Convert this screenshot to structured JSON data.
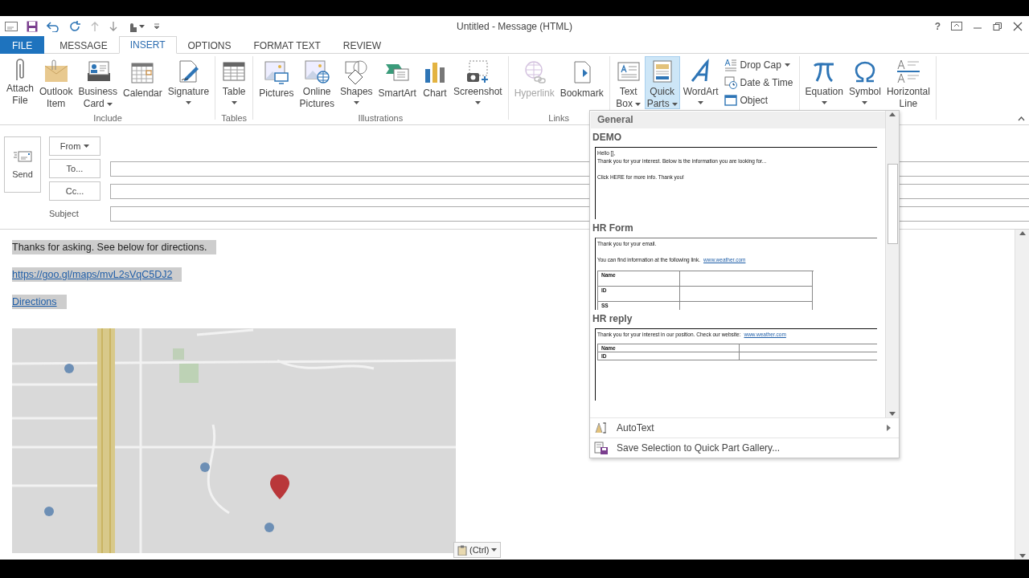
{
  "window": {
    "title": "Untitled - Message (HTML)",
    "help": "?"
  },
  "tabs": [
    {
      "label": "FILE",
      "kind": "file",
      "selected": false
    },
    {
      "label": "MESSAGE",
      "kind": "tab",
      "selected": false
    },
    {
      "label": "INSERT",
      "kind": "tab",
      "selected": true
    },
    {
      "label": "OPTIONS",
      "kind": "tab",
      "selected": false
    },
    {
      "label": "FORMAT TEXT",
      "kind": "tab",
      "selected": false
    },
    {
      "label": "REVIEW",
      "kind": "tab",
      "selected": false
    }
  ],
  "ribbon": {
    "groups": [
      {
        "label": "Include",
        "items": [
          {
            "kind": "large",
            "lines": [
              "Attach",
              "File"
            ],
            "dropdown": false,
            "pressed": false,
            "disabled": false
          },
          {
            "kind": "large",
            "lines": [
              "Outlook",
              "Item"
            ],
            "dropdown": false,
            "pressed": false,
            "disabled": false
          },
          {
            "kind": "large",
            "lines": [
              "Business",
              "Card"
            ],
            "dropdown": true,
            "pressed": false,
            "disabled": false
          },
          {
            "kind": "large",
            "lines": [
              "Calendar"
            ],
            "dropdown": false,
            "pressed": false,
            "disabled": false
          },
          {
            "kind": "large",
            "lines": [
              "Signature"
            ],
            "dropdown": true,
            "pressed": false,
            "disabled": false
          }
        ]
      },
      {
        "label": "Tables",
        "items": [
          {
            "kind": "large",
            "lines": [
              "Table"
            ],
            "dropdown": true,
            "pressed": false,
            "disabled": false
          }
        ]
      },
      {
        "label": "Illustrations",
        "items": [
          {
            "kind": "large",
            "lines": [
              "Pictures"
            ],
            "dropdown": false,
            "pressed": false,
            "disabled": false
          },
          {
            "kind": "large",
            "lines": [
              "Online",
              "Pictures"
            ],
            "dropdown": false,
            "pressed": false,
            "disabled": false
          },
          {
            "kind": "large",
            "lines": [
              "Shapes"
            ],
            "dropdown": true,
            "pressed": false,
            "disabled": false
          },
          {
            "kind": "large",
            "lines": [
              "SmartArt"
            ],
            "dropdown": false,
            "pressed": false,
            "disabled": false
          },
          {
            "kind": "large",
            "lines": [
              "Chart"
            ],
            "dropdown": false,
            "pressed": false,
            "disabled": false
          },
          {
            "kind": "large",
            "lines": [
              "Screenshot"
            ],
            "dropdown": true,
            "pressed": false,
            "disabled": false
          }
        ]
      },
      {
        "label": "Links",
        "items": [
          {
            "kind": "large",
            "lines": [
              "Hyperlink"
            ],
            "dropdown": false,
            "pressed": false,
            "disabled": true
          },
          {
            "kind": "large",
            "lines": [
              "Bookmark"
            ],
            "dropdown": false,
            "pressed": false,
            "disabled": false
          }
        ]
      },
      {
        "items": [
          {
            "kind": "large",
            "lines": [
              "Text",
              "Box"
            ],
            "dropdown": true,
            "pressed": false,
            "disabled": false
          },
          {
            "kind": "large",
            "lines": [
              "Quick",
              "Parts"
            ],
            "dropdown": true,
            "pressed": true,
            "disabled": false
          },
          {
            "kind": "large",
            "lines": [
              "WordArt"
            ],
            "dropdown": true,
            "pressed": false,
            "disabled": false
          },
          {
            "kind": "small",
            "lines": [
              "Drop Cap"
            ],
            "dropdown": true,
            "pressed": false,
            "disabled": false
          },
          {
            "kind": "small",
            "lines": [
              "Date & Time"
            ],
            "dropdown": false,
            "pressed": false,
            "disabled": false
          },
          {
            "kind": "small",
            "lines": [
              "Object"
            ],
            "dropdown": false,
            "pressed": false,
            "disabled": false
          }
        ]
      },
      {
        "items": [
          {
            "kind": "large",
            "lines": [
              "Equation"
            ],
            "dropdown": true,
            "pressed": false,
            "disabled": false
          },
          {
            "kind": "large",
            "lines": [
              "Symbol"
            ],
            "dropdown": true,
            "pressed": false,
            "disabled": false
          },
          {
            "kind": "large",
            "lines": [
              "Horizontal",
              "Line"
            ],
            "dropdown": false,
            "pressed": false,
            "disabled": false
          }
        ]
      }
    ]
  },
  "compose": {
    "send": "Send",
    "rows": [
      {
        "label": "From",
        "kind": "button",
        "dropdown": true,
        "field": false
      },
      {
        "label": "To...",
        "kind": "button",
        "dropdown": false,
        "field": true
      },
      {
        "label": "Cc...",
        "kind": "button",
        "dropdown": false,
        "field": true
      },
      {
        "label": "Subject",
        "kind": "label",
        "dropdown": false,
        "field": true
      }
    ]
  },
  "body": {
    "selected": true,
    "paragraphs": [
      {
        "kind": "text",
        "text": "Thanks for asking. See below for directions."
      },
      {
        "kind": "link",
        "text": "https://goo.gl/maps/mvL2sVqC5DJ2"
      },
      {
        "kind": "link",
        "text": "Directions"
      }
    ],
    "paste_options": {
      "label": "(Ctrl)",
      "dropdown": true
    }
  },
  "quick_parts_menu": {
    "header": "General",
    "entries": [
      {
        "name": "DEMO",
        "kind": "letter",
        "paragraphs": [
          {
            "lines": [
              "Hello [],",
              "Thank you for your interest. Below is the information you are looking for..."
            ]
          },
          {
            "lines": [
              "Click HERE for more info. Thank you!"
            ]
          }
        ]
      },
      {
        "name": "HR Form",
        "kind": "form",
        "paragraphs": [
          {
            "lines": [
              "Thank you for your email."
            ]
          },
          {
            "lines": [
              "You can find information at the following link."
            ],
            "link": "www.weather.com"
          }
        ],
        "table": [
          "Name",
          "ID",
          "SS"
        ]
      },
      {
        "name": "HR reply",
        "kind": "reply",
        "paragraphs": [
          {
            "lines": [
              "Thank you  for your interest in our position. Check our website:"
            ],
            "link": "www.weather.com"
          }
        ],
        "table": [
          "Name",
          "ID"
        ]
      }
    ],
    "commands": [
      {
        "label": "AutoText",
        "submenu": true
      },
      {
        "label": "Save Selection to Quick Part Gallery...",
        "submenu": false
      }
    ]
  }
}
